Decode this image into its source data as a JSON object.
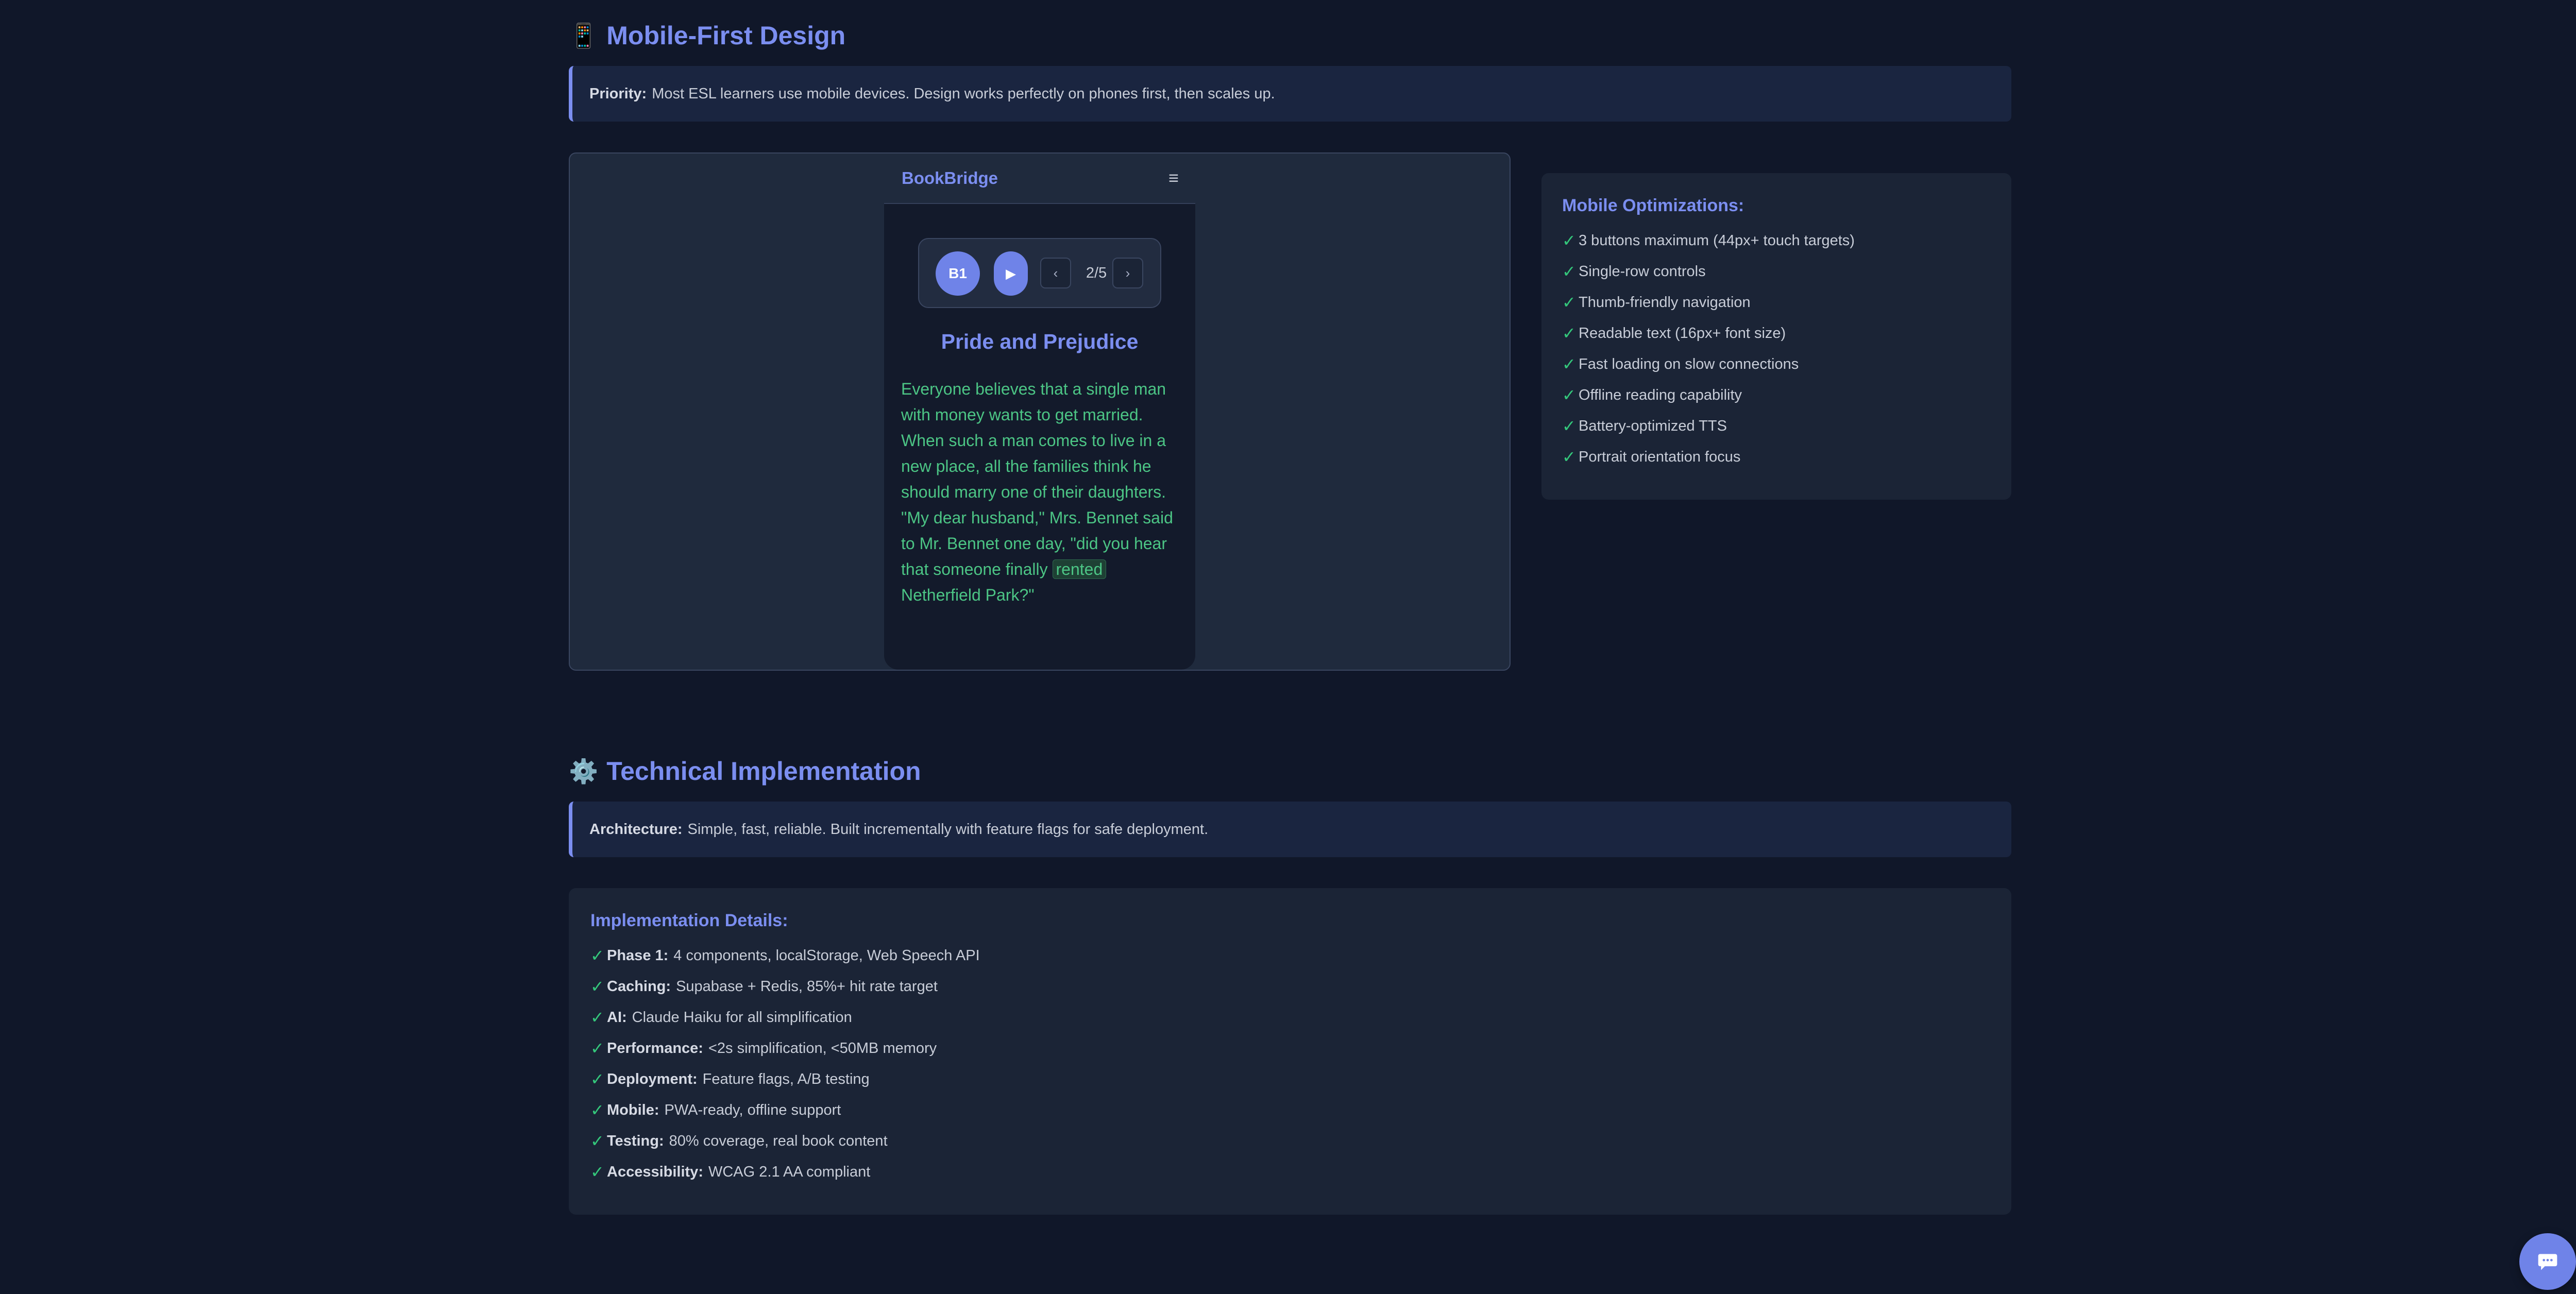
{
  "mobile_section": {
    "icon": "mobile-phone-icon",
    "emoji": "📱",
    "title": "Mobile-First Design",
    "callout_label": "Priority:",
    "callout_text": "Most ESL learners use mobile devices. Design works perfectly on phones first, then scales up."
  },
  "phone_demo": {
    "brand": "BookBridge",
    "menu_glyph": "≡",
    "level": "B1",
    "play_glyph": "▶",
    "prev_glyph": "‹",
    "next_glyph": "›",
    "page_indicator": "2/5",
    "book_title": "Pride and Prejudice",
    "story_before": "Everyone believes that a single man with money wants to get married. When such a man comes to live in a new place, all the families think he should marry one of their daughters. \"My dear husband,\" Mrs. Bennet said to Mr. Bennet one day, \"did you hear that someone finally",
    "story_highlight": "rented",
    "story_after": "Netherfield Park?\""
  },
  "mobile_optimizations": {
    "title": "Mobile Optimizations:",
    "items": [
      "3 buttons maximum (44px+ touch targets)",
      "Single-row controls",
      "Thumb-friendly navigation",
      "Readable text (16px+ font size)",
      "Fast loading on slow connections",
      "Offline reading capability",
      "Battery-optimized TTS",
      "Portrait orientation focus"
    ]
  },
  "tech_section": {
    "icon": "gear-icon",
    "emoji": "⚙️",
    "title": "Technical Implementation",
    "callout_label": "Architecture:",
    "callout_text": "Simple, fast, reliable. Built incrementally with feature flags for safe deployment."
  },
  "implementation_details": {
    "title": "Implementation Details:",
    "items": [
      {
        "label": "Phase 1:",
        "text": "4 components, localStorage, Web Speech API"
      },
      {
        "label": "Caching:",
        "text": "Supabase + Redis, 85%+ hit rate target"
      },
      {
        "label": "AI:",
        "text": "Claude Haiku for all simplification"
      },
      {
        "label": "Performance:",
        "text": "<2s simplification, <50MB memory"
      },
      {
        "label": "Deployment:",
        "text": "Feature flags, A/B testing"
      },
      {
        "label": "Mobile:",
        "text": "PWA-ready, offline support"
      },
      {
        "label": "Testing:",
        "text": "80% coverage, real book content"
      },
      {
        "label": "Accessibility:",
        "text": "WCAG 2.1 AA compliant"
      }
    ]
  },
  "check_glyph": "✓",
  "chat_button": {
    "icon": "chat-bubble-icon"
  },
  "colors": {
    "background": "#101729",
    "accent": "#7b8ef0",
    "check": "#34c77b",
    "story_text": "#4cc585",
    "panel": "#1b2436"
  }
}
